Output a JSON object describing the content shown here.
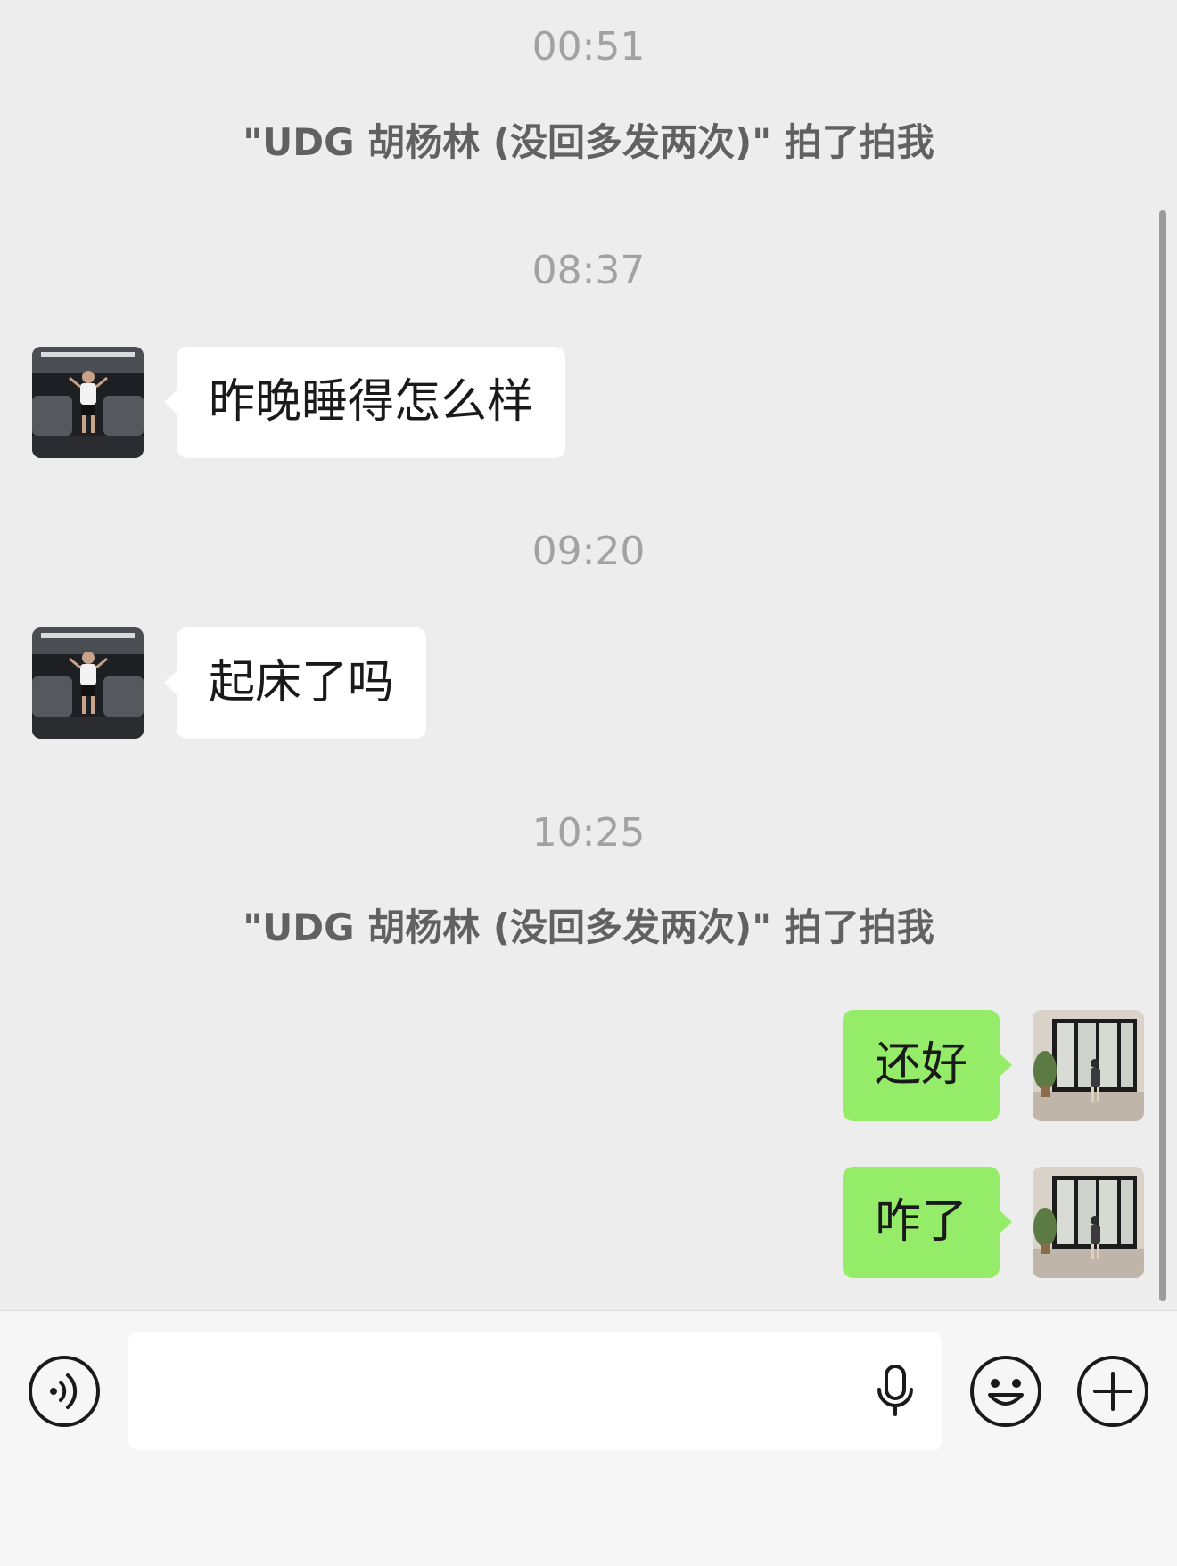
{
  "messages": {
    "t1": "00:51",
    "sys1": "\"UDG 胡杨林 (没回多发两次)\" 拍了拍我",
    "t2": "08:37",
    "m1": "昨晚睡得怎么样",
    "t3": "09:20",
    "m2": "起床了吗",
    "t4": "10:25",
    "sys2": "\"UDG 胡杨林 (没回多发两次)\" 拍了拍我",
    "m3": "还好",
    "m4": "咋了"
  },
  "colors": {
    "chat_bg": "#ededed",
    "incoming_bubble": "#ffffff",
    "outgoing_bubble": "#95ec69",
    "timestamp": "#a2a2a2",
    "system_text": "#616161"
  },
  "icons": {
    "voice": "voice-toggle-icon",
    "mic": "microphone-icon",
    "emoji": "emoji-icon",
    "plus": "plus-icon"
  }
}
